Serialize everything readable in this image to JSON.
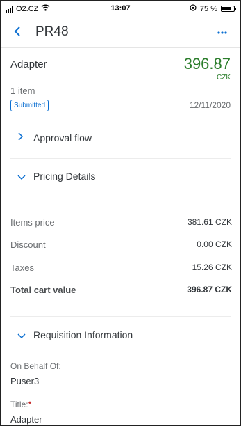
{
  "status_bar": {
    "carrier": "O2.CZ",
    "time": "13:07",
    "battery_percent": "75 %",
    "battery_level": 0.75
  },
  "header": {
    "title": "PR48",
    "back_icon": "chevron-left-icon",
    "more_icon": "more-icon"
  },
  "summary": {
    "item_name": "Adapter",
    "amount": "396.87",
    "currency": "CZK",
    "item_count": "1 item",
    "status": "Submitted",
    "date": "12/11/2020"
  },
  "sections": {
    "approval_flow": {
      "label": "Approval flow",
      "expanded": false
    },
    "pricing_details": {
      "label": "Pricing Details",
      "expanded": true
    },
    "requisition_info": {
      "label": "Requisition Information",
      "expanded": true
    }
  },
  "pricing": {
    "rows": [
      {
        "label": "Items price",
        "value": "381.61 CZK"
      },
      {
        "label": "Discount",
        "value": "0.00 CZK"
      },
      {
        "label": "Taxes",
        "value": "15.26 CZK"
      }
    ],
    "total": {
      "label": "Total cart value",
      "value": "396.87 CZK"
    }
  },
  "requisition": {
    "on_behalf_label": "On Behalf Of:",
    "on_behalf_value": "Puser3",
    "title_label": "Title:",
    "title_required": "*",
    "title_value": "Adapter"
  },
  "colors": {
    "accent": "#0a6ed1",
    "amount": "#2b7d2b",
    "required": "#bb0000"
  }
}
